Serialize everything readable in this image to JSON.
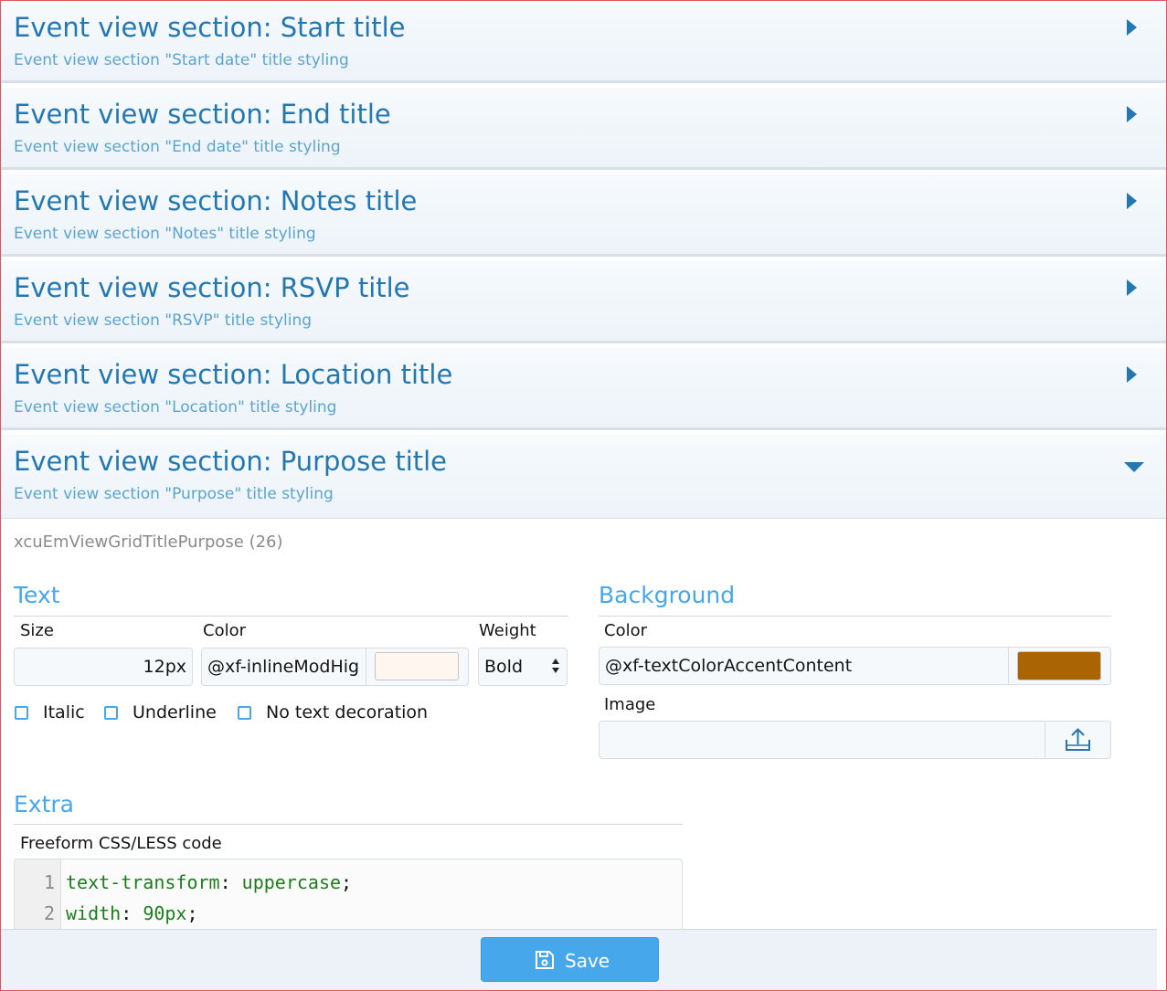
{
  "sections": [
    {
      "title": "Event view section: Start title",
      "desc": "Event view section \"Start date\" title styling"
    },
    {
      "title": "Event view section: End title",
      "desc": "Event view section \"End date\" title styling"
    },
    {
      "title": "Event view section: Notes title",
      "desc": "Event view section \"Notes\" title styling"
    },
    {
      "title": "Event view section: RSVP title",
      "desc": "Event view section \"RSVP\" title styling"
    },
    {
      "title": "Event view section: Location title",
      "desc": "Event view section \"Location\" title styling"
    },
    {
      "title": "Event view section: Purpose title",
      "desc": "Event view section \"Purpose\" title styling"
    }
  ],
  "collapsed_icon": "chevron-right-icon",
  "expanded_icon": "chevron-down-icon",
  "identifier": "xcuEmViewGridTitlePurpose (26)",
  "text_group": {
    "heading": "Text",
    "size_label": "Size",
    "size_value": "12px",
    "color_label": "Color",
    "color_value": "@xf-inlineModHig",
    "color_swatch": "#fff7ef",
    "weight_label": "Weight",
    "weight_value": "Bold",
    "checkboxes": {
      "italic": "Italic",
      "underline": "Underline",
      "no_decoration": "No text decoration"
    }
  },
  "background_group": {
    "heading": "Background",
    "color_label": "Color",
    "color_value": "@xf-textColorAccentContent",
    "color_swatch": "#aa6404",
    "image_label": "Image",
    "image_value": "",
    "upload_icon": "upload-icon"
  },
  "extra_group": {
    "heading": "Extra",
    "code_label": "Freeform CSS/LESS code",
    "code_lines": [
      {
        "num": "1",
        "prop": "text-transform",
        "value": "uppercase"
      },
      {
        "num": "2",
        "prop": "width",
        "value": "90px"
      }
    ]
  },
  "footer": {
    "save_label": "Save",
    "save_icon": "save-icon"
  },
  "colors": {
    "accent": "#47a7eb",
    "title_blue": "#2577b1",
    "frame": "#e0555d"
  }
}
